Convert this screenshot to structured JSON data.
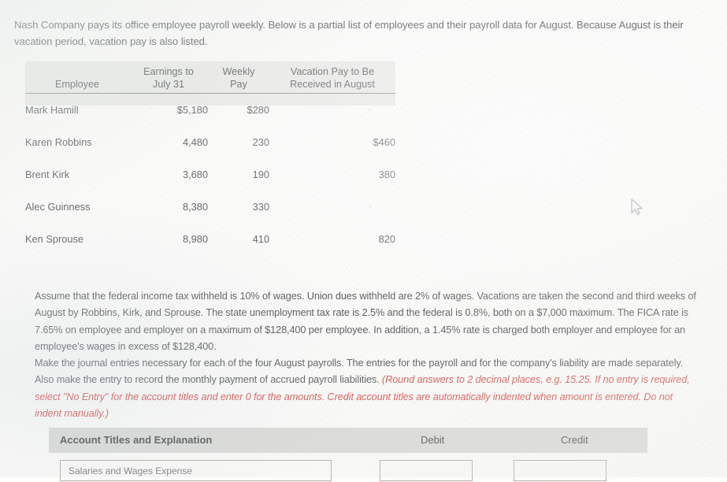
{
  "intro": {
    "text": "Nash Company pays its office employee payroll weekly. Below is a partial list of employees and their payroll data for August. Because August is their vacation period, vacation pay is also listed."
  },
  "payroll_table": {
    "columns": [
      {
        "key": "employee",
        "label_top": "",
        "label_bottom": "Employee"
      },
      {
        "key": "earnings",
        "label_top": "Earnings to",
        "label_bottom": "July 31"
      },
      {
        "key": "weekly",
        "label_top": "Weekly",
        "label_bottom": "Pay"
      },
      {
        "key": "vacation",
        "label_top": "Vacation Pay to Be",
        "label_bottom": "Received in August"
      }
    ],
    "rows": [
      {
        "employee": "Mark Hamill",
        "earnings": "$5,180",
        "weekly": "$280",
        "vacation": "-",
        "vacation_is_dash": true
      },
      {
        "employee": "Karen Robbins",
        "earnings": "4,480",
        "weekly": "230",
        "vacation": "$460",
        "vacation_is_dash": false
      },
      {
        "employee": "Brent Kirk",
        "earnings": "3,680",
        "weekly": "190",
        "vacation": "380",
        "vacation_is_dash": false
      },
      {
        "employee": "Alec Guinness",
        "earnings": "8,380",
        "weekly": "330",
        "vacation": "-",
        "vacation_is_dash": true
      },
      {
        "employee": "Ken Sprouse",
        "earnings": "8,980",
        "weekly": "410",
        "vacation": "820",
        "vacation_is_dash": false
      }
    ]
  },
  "assumptions": {
    "text": "Assume that the federal income tax withheld is 10% of wages. Union dues withheld are 2% of wages. Vacations are taken the second and third weeks of August by Robbins, Kirk, and Sprouse. The state unemployment tax rate is 2.5% and the federal is 0.8%, both on a $7,000 maximum. The FICA rate is 7.65% on employee and employer on a maximum of $128,400 per employee. In addition, a 1.45% rate is charged both employer and employee for an employee's wages in excess of $128,400."
  },
  "instructions": {
    "text_plain": "Make the journal entries necessary for each of the four August payrolls. The entries for the payroll and for the company's liability are made separately. Also make the entry to record the monthly payment of accrued payroll liabilities. ",
    "text_note": "(Round answers to 2 decimal places, e.g. 15.25. If no entry is required, select \"No Entry\" for the account titles and enter 0 for the amounts. Credit account titles are automatically indented when amount is entered. Do not indent manually.)"
  },
  "journal": {
    "header": {
      "account": "Account Titles and Explanation",
      "debit": "Debit",
      "credit": "Credit"
    },
    "rows": [
      {
        "account": "Salaries and Wages Expense",
        "debit": "",
        "credit": ""
      }
    ]
  },
  "colors": {
    "background": "#fdfdfb",
    "text": "#56585b",
    "note_red": "#d9534f",
    "header_band": "#e1e2de",
    "journal_header_band": "#cdcecа",
    "input_border": "#b9a9a4"
  }
}
